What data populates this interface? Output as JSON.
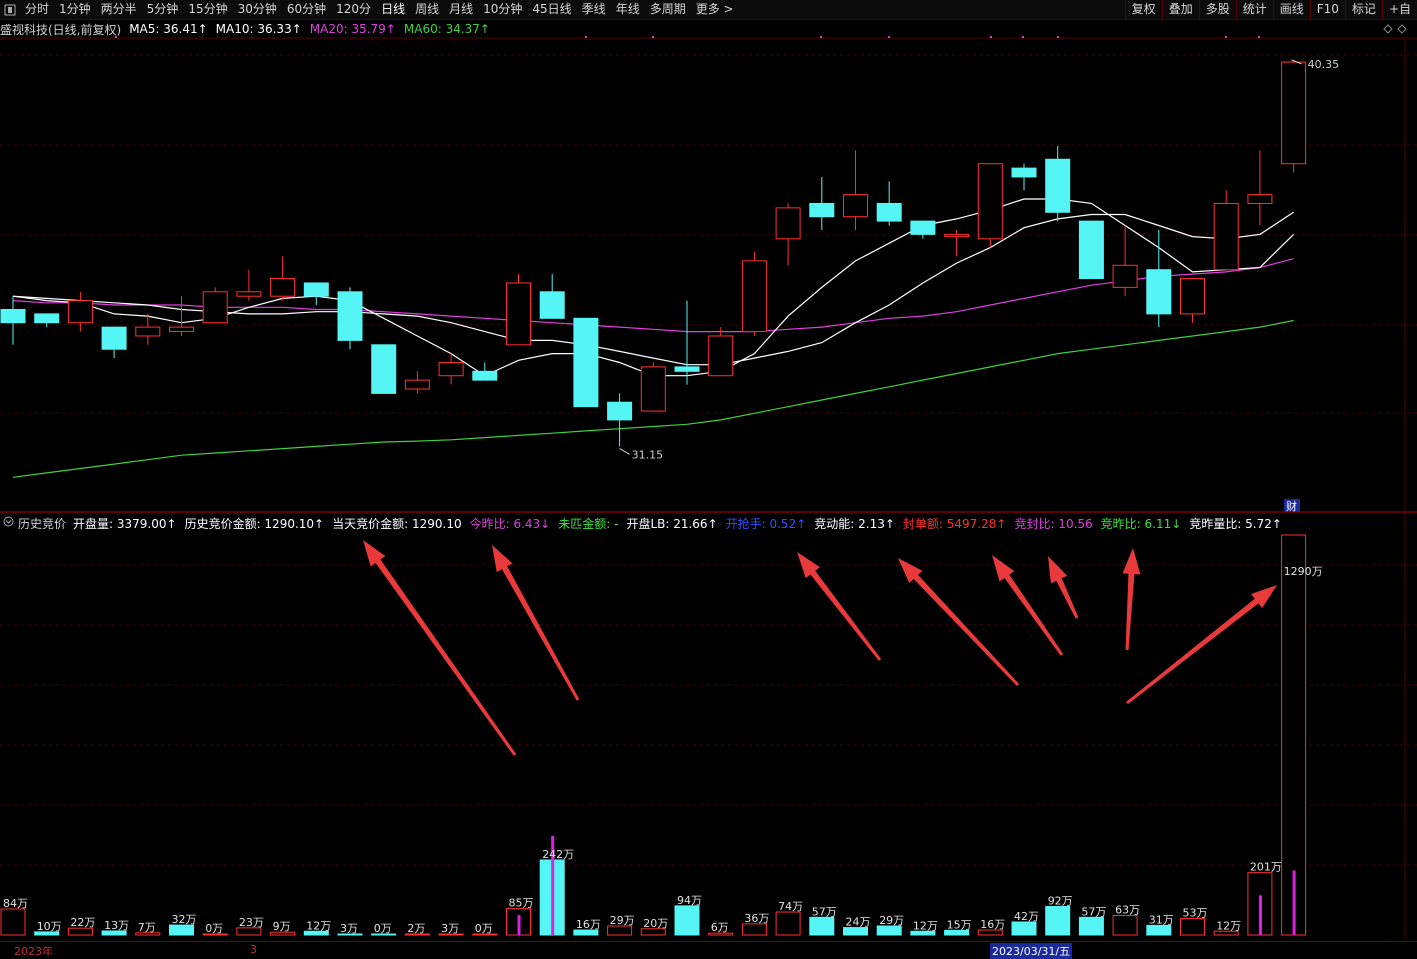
{
  "toolbar": {
    "tabs": [
      "分时",
      "1分钟",
      "两分半",
      "5分钟",
      "15分钟",
      "30分钟",
      "60分钟",
      "120分",
      "日线",
      "周线",
      "月线",
      "10分钟",
      "45日线",
      "季线",
      "年线",
      "多周期",
      "更多 >"
    ],
    "active": "日线",
    "right_buttons": [
      "复权",
      "叠加",
      "多股",
      "统计",
      "画线",
      "F10",
      "标记",
      "+自"
    ]
  },
  "title": {
    "name": "盛视科技(日线,前复权)",
    "ma5": "MA5: 36.41↑",
    "ma10": "MA10: 36.33↑",
    "ma20": "MA20: 35.79↑",
    "ma60": "MA60: 34.37↑"
  },
  "colors": {
    "ma5": "#ffffff",
    "ma10": "#ffffff",
    "ma20": "#e040e0",
    "ma60": "#40d040",
    "up": "#ff3030",
    "down": "#55f5f5"
  },
  "price_labels": {
    "high": "40.35",
    "low": "31.15",
    "cai": "财"
  },
  "indicator": {
    "name": "历史竞价",
    "items": [
      {
        "label": "开盘量: 3379.00↑",
        "color": "#ffffff"
      },
      {
        "label": "历史竞价金额: 1290.10↑",
        "color": "#ffffff"
      },
      {
        "label": "当天竞价金额: 1290.10",
        "color": "#ffffff"
      },
      {
        "label": "今昨比: 6.43↓",
        "color": "#e040e0"
      },
      {
        "label": "未匹金额: -",
        "color": "#40e040"
      },
      {
        "label": "开盘LB: 21.66↑",
        "color": "#ffffff"
      },
      {
        "label": "开抢手: 0.52↑",
        "color": "#3050ff"
      },
      {
        "label": "竞动能: 2.13↑",
        "color": "#ffffff"
      },
      {
        "label": "封单额: 5497.28↑",
        "color": "#ff3030"
      },
      {
        "label": "竞封比: 10.56",
        "color": "#e040e0"
      },
      {
        "label": "竞昨比: 6.11↓",
        "color": "#40e040"
      },
      {
        "label": "竞昨量比: 5.72↑",
        "color": "#ffffff"
      }
    ]
  },
  "volume_labels": [
    "84万",
    "10万",
    "22万",
    "13万",
    "7万",
    "32万",
    "0万",
    "23万",
    "9万",
    "12万",
    "3万",
    "0万",
    "2万",
    "3万",
    "0万",
    "85万",
    "242万",
    "16万",
    "29万",
    "20万",
    "94万",
    "6万",
    "36万",
    "74万",
    "57万",
    "24万",
    "29万",
    "12万",
    "15万",
    "16万",
    "42万",
    "92万",
    "57万",
    "63万",
    "31万",
    "53万",
    "12万",
    "201万",
    "1290万"
  ],
  "xaxis": {
    "year": "2023年",
    "month": "3",
    "date": "2023/03/31/五"
  },
  "chart_data": {
    "type": "candlestick",
    "candles": [
      {
        "o": 34.7,
        "c": 34.4,
        "h": 35.0,
        "l": 33.9
      },
      {
        "o": 34.6,
        "c": 34.4,
        "h": 34.6,
        "l": 34.3
      },
      {
        "o": 34.4,
        "c": 34.9,
        "h": 35.1,
        "l": 34.2
      },
      {
        "o": 34.3,
        "c": 33.8,
        "h": 34.3,
        "l": 33.6
      },
      {
        "o": 34.1,
        "c": 34.3,
        "h": 34.6,
        "l": 33.9
      },
      {
        "o": 34.2,
        "c": 34.3,
        "h": 35.0,
        "l": 34.1
      },
      {
        "o": 34.4,
        "c": 35.1,
        "h": 35.2,
        "l": 34.4
      },
      {
        "o": 35.0,
        "c": 35.1,
        "h": 35.6,
        "l": 34.9
      },
      {
        "o": 35.0,
        "c": 35.4,
        "h": 35.9,
        "l": 34.9
      },
      {
        "o": 35.3,
        "c": 35.0,
        "h": 35.3,
        "l": 34.8
      },
      {
        "o": 35.1,
        "c": 34.0,
        "h": 35.2,
        "l": 33.8
      },
      {
        "o": 33.9,
        "c": 32.8,
        "h": 33.9,
        "l": 32.8
      },
      {
        "o": 32.9,
        "c": 33.1,
        "h": 33.3,
        "l": 32.8
      },
      {
        "o": 33.2,
        "c": 33.5,
        "h": 33.7,
        "l": 33.0
      },
      {
        "o": 33.3,
        "c": 33.1,
        "h": 33.5,
        "l": 33.1
      },
      {
        "o": 33.9,
        "c": 35.3,
        "h": 35.5,
        "l": 33.9
      },
      {
        "o": 35.1,
        "c": 34.5,
        "h": 35.5,
        "l": 34.5
      },
      {
        "o": 34.5,
        "c": 32.5,
        "h": 34.5,
        "l": 32.5
      },
      {
        "o": 32.6,
        "c": 32.2,
        "h": 32.8,
        "l": 31.6
      },
      {
        "o": 32.4,
        "c": 33.4,
        "h": 33.5,
        "l": 32.4
      },
      {
        "o": 33.4,
        "c": 33.3,
        "h": 34.9,
        "l": 33.0
      },
      {
        "o": 33.2,
        "c": 34.1,
        "h": 34.3,
        "l": 33.2
      },
      {
        "o": 34.2,
        "c": 35.8,
        "h": 36.0,
        "l": 34.1
      },
      {
        "o": 36.3,
        "c": 37.0,
        "h": 37.1,
        "l": 35.7
      },
      {
        "o": 37.1,
        "c": 36.8,
        "h": 37.7,
        "l": 36.5
      },
      {
        "o": 36.8,
        "c": 37.3,
        "h": 38.3,
        "l": 36.5
      },
      {
        "o": 37.1,
        "c": 36.7,
        "h": 37.6,
        "l": 36.6
      },
      {
        "o": 36.7,
        "c": 36.4,
        "h": 36.7,
        "l": 36.3
      },
      {
        "o": 36.4,
        "c": 36.4,
        "h": 36.5,
        "l": 35.9
      },
      {
        "o": 36.3,
        "c": 38.0,
        "h": 38.0,
        "l": 36.1
      },
      {
        "o": 37.9,
        "c": 37.7,
        "h": 38.0,
        "l": 37.4
      },
      {
        "o": 38.1,
        "c": 36.9,
        "h": 38.4,
        "l": 36.7
      },
      {
        "o": 36.7,
        "c": 35.4,
        "h": 36.7,
        "l": 35.4
      },
      {
        "o": 35.2,
        "c": 35.7,
        "h": 36.6,
        "l": 35.0
      },
      {
        "o": 35.6,
        "c": 34.6,
        "h": 36.5,
        "l": 34.3
      },
      {
        "o": 34.6,
        "c": 35.4,
        "h": 35.4,
        "l": 34.4
      },
      {
        "o": 35.6,
        "c": 37.1,
        "h": 37.4,
        "l": 35.6
      },
      {
        "o": 37.1,
        "c": 37.3,
        "h": 38.3,
        "l": 36.6
      },
      {
        "o": 38.0,
        "c": 40.3,
        "h": 40.35,
        "l": 37.8
      }
    ],
    "ma5": [
      35.0,
      34.9,
      34.85,
      34.6,
      34.55,
      34.4,
      34.5,
      34.75,
      34.95,
      35.0,
      34.9,
      34.5,
      34.1,
      33.7,
      33.2,
      33.55,
      33.7,
      33.7,
      33.5,
      33.2,
      33.2,
      33.3,
      33.7,
      34.55,
      35.2,
      35.8,
      36.2,
      36.6,
      36.75,
      36.95,
      37.2,
      37.2,
      37.1,
      36.6,
      36.1,
      35.55,
      35.6,
      35.65,
      36.4
    ],
    "ma10": [
      35.0,
      34.95,
      34.9,
      34.85,
      34.8,
      34.7,
      34.65,
      34.6,
      34.6,
      34.65,
      34.65,
      34.6,
      34.55,
      34.4,
      34.2,
      34.0,
      34.0,
      33.9,
      33.75,
      33.6,
      33.45,
      33.45,
      33.6,
      33.75,
      33.95,
      34.4,
      34.8,
      35.3,
      35.75,
      36.1,
      36.55,
      36.75,
      36.85,
      36.85,
      36.6,
      36.35,
      36.3,
      36.4,
      36.9
    ],
    "ma20": [
      34.9,
      34.85,
      34.85,
      34.8,
      34.8,
      34.8,
      34.75,
      34.75,
      34.75,
      34.7,
      34.7,
      34.65,
      34.6,
      34.55,
      34.5,
      34.45,
      34.4,
      34.35,
      34.3,
      34.25,
      34.2,
      34.2,
      34.2,
      34.25,
      34.3,
      34.4,
      34.5,
      34.55,
      34.65,
      34.8,
      34.95,
      35.1,
      35.25,
      35.35,
      35.45,
      35.5,
      35.55,
      35.65,
      35.85
    ],
    "ma60": [
      30.9,
      31.0,
      31.1,
      31.2,
      31.3,
      31.4,
      31.45,
      31.5,
      31.55,
      31.6,
      31.65,
      31.7,
      31.72,
      31.75,
      31.8,
      31.85,
      31.9,
      31.95,
      32.0,
      32.05,
      32.1,
      32.2,
      32.35,
      32.5,
      32.65,
      32.8,
      32.95,
      33.1,
      33.25,
      33.4,
      33.55,
      33.7,
      33.8,
      33.9,
      34.0,
      34.1,
      34.2,
      34.3,
      34.45
    ],
    "volume": [
      84,
      10,
      22,
      13,
      7,
      32,
      0,
      23,
      9,
      12,
      3,
      0,
      2,
      3,
      0,
      85,
      242,
      16,
      29,
      20,
      94,
      6,
      36,
      74,
      57,
      24,
      29,
      12,
      15,
      16,
      42,
      92,
      57,
      63,
      31,
      53,
      12,
      201,
      1290
    ],
    "volume_dir": [
      "u",
      "d",
      "u",
      "d",
      "u",
      "d",
      "u",
      "u",
      "u",
      "d",
      "d",
      "d",
      "u",
      "u",
      "u",
      "u",
      "d",
      "d",
      "u",
      "u",
      "d",
      "u",
      "u",
      "u",
      "d",
      "d",
      "d",
      "d",
      "d",
      "u",
      "d",
      "d",
      "d",
      "u",
      "d",
      "u",
      "u",
      "u",
      "u"
    ],
    "purple_bars": [
      0,
      0,
      0,
      0,
      0,
      0,
      0,
      0,
      0,
      0,
      0,
      0,
      0,
      0,
      0,
      20,
      100,
      0,
      0,
      0,
      0,
      0,
      0,
      0,
      0,
      0,
      0,
      0,
      0,
      0,
      0,
      0,
      0,
      0,
      0,
      0,
      0,
      40,
      260
    ],
    "y_range": [
      30.5,
      40.8
    ]
  }
}
